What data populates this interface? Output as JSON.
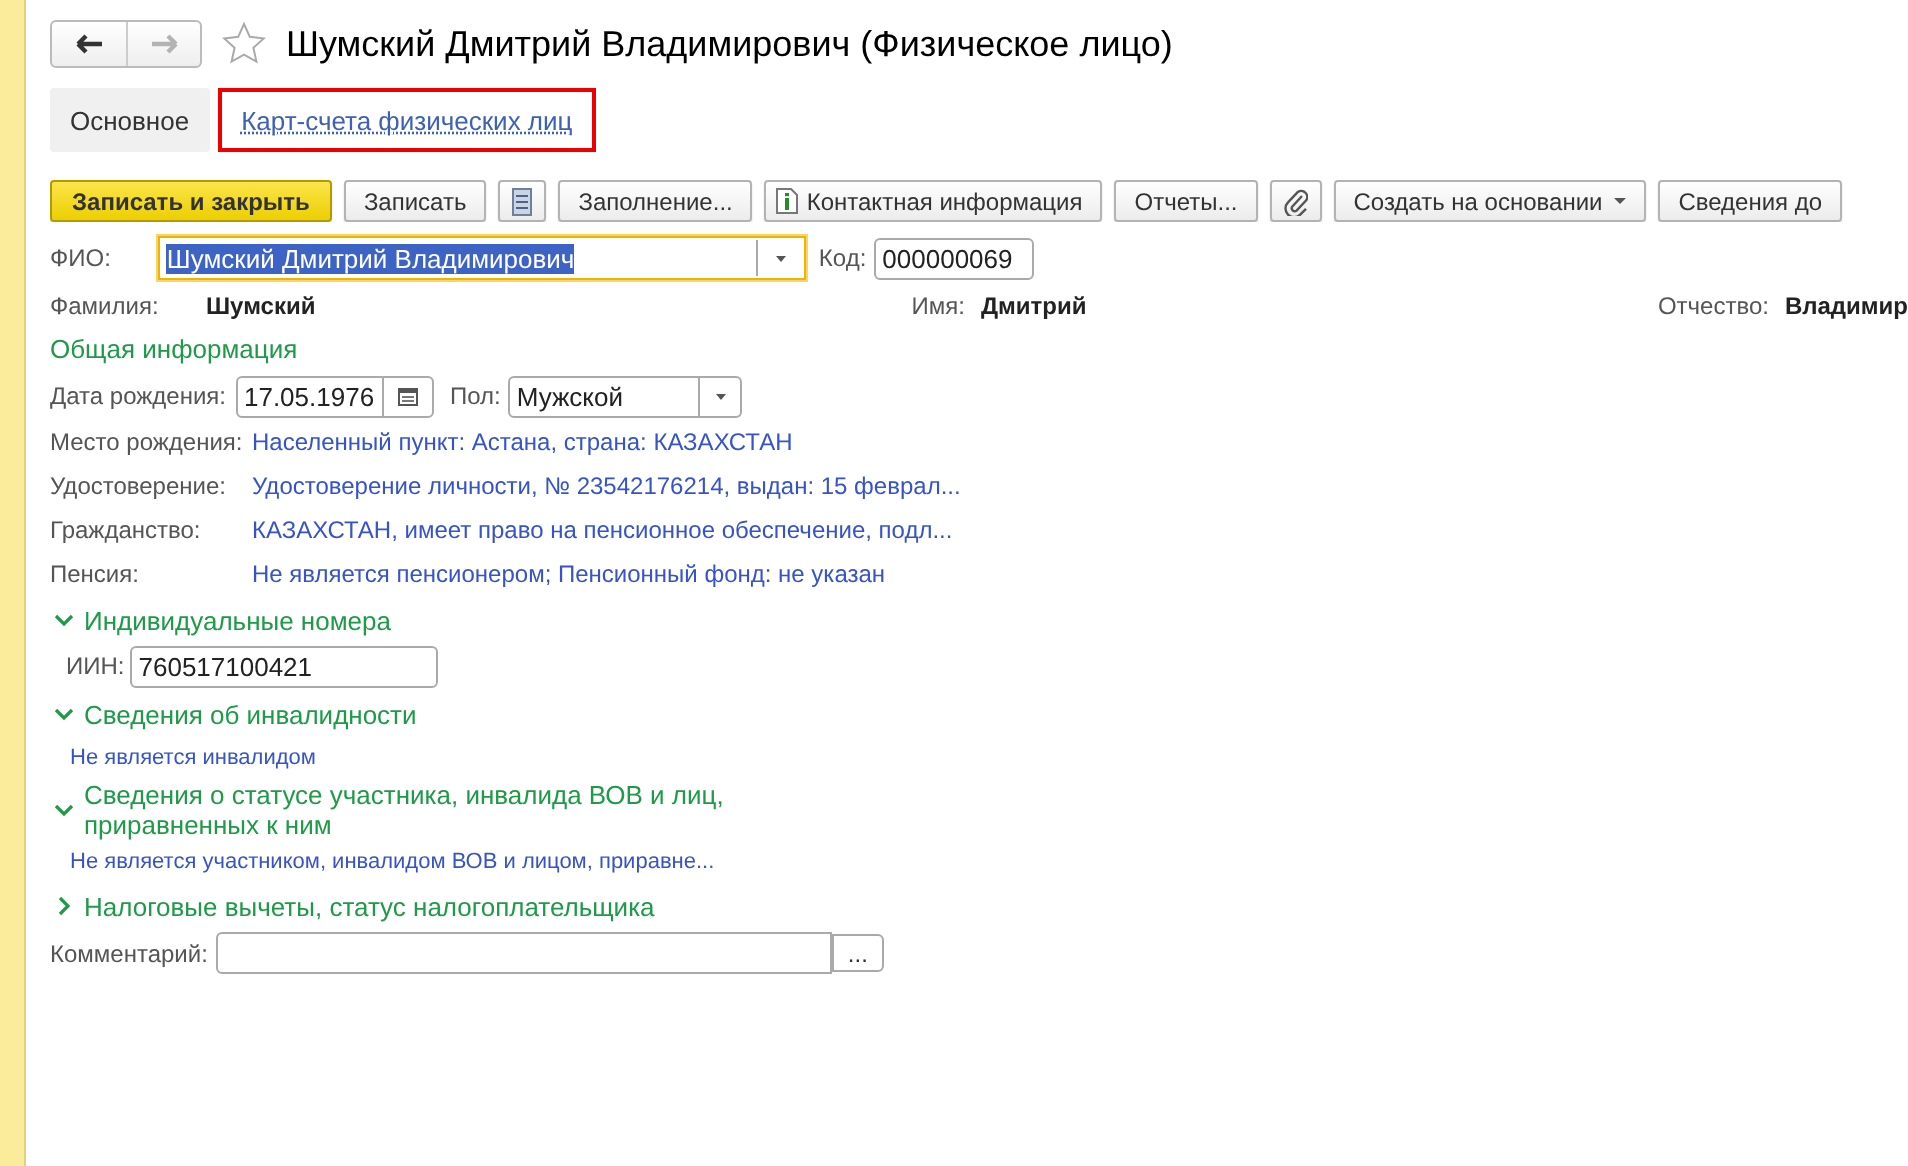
{
  "nav": {
    "back_disabled": false,
    "forward_disabled": true
  },
  "favorite": false,
  "title": "Шумский Дмитрий Владимирович (Физическое лицо)",
  "tabs": [
    {
      "label": "Основное",
      "selected": true,
      "highlighted": false
    },
    {
      "label": "Карт-счета физических лиц",
      "selected": false,
      "highlighted": true
    }
  ],
  "toolbar": [
    {
      "kind": "primary",
      "label": "Записать и закрыть"
    },
    {
      "kind": "text",
      "label": "Записать"
    },
    {
      "kind": "list"
    },
    {
      "kind": "text",
      "label": "Заполнение..."
    },
    {
      "kind": "info",
      "label": "Контактная информация"
    },
    {
      "kind": "text",
      "label": "Отчеты..."
    },
    {
      "kind": "attach"
    },
    {
      "kind": "menu",
      "label": "Создать на основании"
    },
    {
      "kind": "text",
      "label": "Сведения до"
    }
  ],
  "fio": {
    "label": "ФИО:",
    "value": "Шумский Дмитрий Владимирович",
    "focused": true
  },
  "code": {
    "label": "Код:",
    "value": "000000069"
  },
  "name_parts": [
    {
      "label": "Фамилия:",
      "value": "Шумский"
    },
    {
      "label": "Имя:",
      "value": "Дмитрий"
    },
    {
      "label": "Отчество:",
      "value": "Владимир"
    }
  ],
  "general": {
    "title": "Общая информация",
    "birth_date": {
      "label": "Дата рождения:",
      "value": "17.05.1976"
    },
    "sex": {
      "label": "Пол:",
      "value": "Мужской"
    },
    "rows": [
      {
        "label": "Место рождения:",
        "value": "Населенный пункт: Астана, страна: КАЗАХСТАН"
      },
      {
        "label": "Удостоверение:",
        "value": "Удостоверение личности, № 23542176214, выдан: 15 феврал..."
      },
      {
        "label": "Гражданство:",
        "value": "КАЗАХСТАН, имеет право на пенсионное обеспечение, подл..."
      },
      {
        "label": "Пенсия:",
        "value": "Не является пенсионером; Пенсионный фонд: не указан"
      }
    ]
  },
  "sections": [
    {
      "title": "Индивидуальные номера",
      "expanded": true,
      "field": {
        "label": "ИИН:",
        "value": "760517100421"
      }
    },
    {
      "title": "Сведения об инвалидности",
      "expanded": true,
      "text": "Не является инвалидом"
    },
    {
      "title": "Сведения о статусе участника, инвалида ВОВ и лиц, приравненных к ним",
      "expanded": true,
      "text": "Не является участником, инвалидом ВОВ и лицом, приравне..."
    },
    {
      "title": "Налоговые вычеты, статус налогоплательщика",
      "expanded": false
    }
  ],
  "comment": {
    "label": "Комментарий:",
    "button": "..."
  }
}
